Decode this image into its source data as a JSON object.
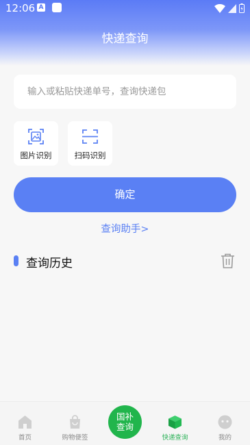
{
  "status_bar": {
    "time": "12:06",
    "notif_a": "A"
  },
  "header": {
    "title": "快递查询"
  },
  "search": {
    "placeholder": "输入或粘贴快递单号，查询快递包"
  },
  "tools": [
    {
      "label": "图片识别",
      "icon": "image-icon"
    },
    {
      "label": "扫码识别",
      "icon": "scan-icon"
    }
  ],
  "confirm_label": "确定",
  "helper_link": "查询助手>",
  "history": {
    "title": "查询历史",
    "icon": "trash-icon"
  },
  "tabbar": {
    "items": [
      {
        "label": "首页",
        "icon": "home-icon",
        "active": false
      },
      {
        "label": "购物便签",
        "icon": "shopping-bag-icon",
        "active": false
      },
      {
        "label": "快递查询",
        "icon": "package-icon",
        "active": true
      },
      {
        "label": "我的",
        "icon": "profile-icon",
        "active": false
      }
    ],
    "center": {
      "line1": "国补",
      "line2": "查询"
    }
  },
  "colors": {
    "accent": "#5a80f4",
    "tab_active": "#2fb35a",
    "center_button": "#21b54c"
  }
}
